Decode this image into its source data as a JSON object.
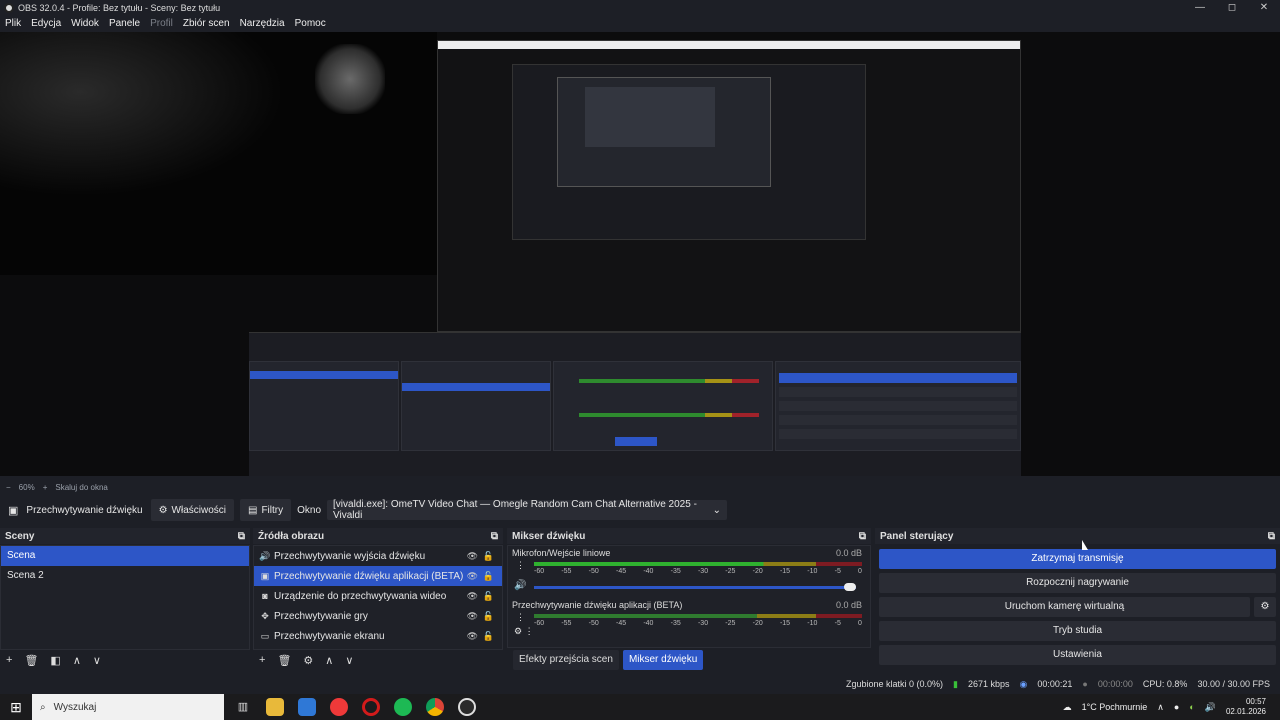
{
  "window": {
    "title": "OBS 32.0.4 - Profile: Bez tytułu - Sceny: Bez tytułu",
    "min": "—",
    "max": "◻",
    "close": "✕"
  },
  "menu": [
    "Plik",
    "Edycja",
    "Widok",
    "Panele",
    "Profil",
    "Zbiór scen",
    "Narzędzia",
    "Pomoc"
  ],
  "preview_status": {
    "zoom": "60%",
    "scale_label": "Skaluj do okna",
    "minus": "−",
    "plus": "+"
  },
  "source_bar": {
    "source_name": "Przechwytywanie dźwięku",
    "properties": "Właściwości",
    "filters": "Filtry",
    "window_label": "Okno",
    "window_value": "[vivaldi.exe]: OmeTV Video Chat — Omegle Random Cam Chat Alternative 2025 - Vivaldi"
  },
  "scenes": {
    "title": "Sceny",
    "items": [
      "Scena",
      "Scena 2"
    ],
    "selected": 0
  },
  "sources": {
    "title": "Źródła obrazu",
    "items": [
      {
        "label": "Przechwytywanie wyjścia dźwięku",
        "icon": "speaker-icon"
      },
      {
        "label": "Przechwytywanie dźwięku aplikacji (BETA)",
        "icon": "app-audio-icon"
      },
      {
        "label": "Urządzenie do przechwytywania wideo",
        "icon": "camera-icon"
      },
      {
        "label": "Przechwytywanie gry",
        "icon": "gamepad-icon"
      },
      {
        "label": "Przechwytywanie ekranu",
        "icon": "monitor-icon"
      }
    ],
    "selected": 1
  },
  "mixer": {
    "title": "Mikser dźwięku",
    "channels": [
      {
        "name": "Mikrofon/Wejście liniowe",
        "db": "0.0 dB"
      },
      {
        "name": "Przechwytywanie dźwięku aplikacji (BETA)",
        "db": "0.0 dB"
      }
    ],
    "ticks": [
      "-60",
      "-55",
      "-50",
      "-45",
      "-40",
      "-35",
      "-30",
      "-25",
      "-20",
      "-15",
      "-10",
      "-5",
      "0"
    ],
    "tabs": [
      "Efekty przejścia scen",
      "Mikser dźwięku"
    ],
    "active_tab": 1
  },
  "controls": {
    "title": "Panel sterujący",
    "buttons": [
      "Zatrzymaj transmisję",
      "Rozpocznij nagrywanie",
      "Uruchom kamerę wirtualną",
      "Tryb studia",
      "Ustawienia"
    ]
  },
  "status": {
    "dropped": "Zgubione klatki 0 (0.0%)",
    "bitrate": "2671 kbps",
    "stream_time": "00:00:21",
    "rec_time": "00:00:00",
    "cpu": "CPU: 0.8%",
    "fps": "30.00 / 30.00 FPS"
  },
  "taskbar": {
    "search_placeholder": "Wyszukaj",
    "weather": "1°C  Pochmurnie",
    "time": "00:57",
    "date": "02.01.2026"
  },
  "colors": {
    "accent": "#2d56c7",
    "bg": "#1d1f26",
    "panel": "#1f2128"
  }
}
